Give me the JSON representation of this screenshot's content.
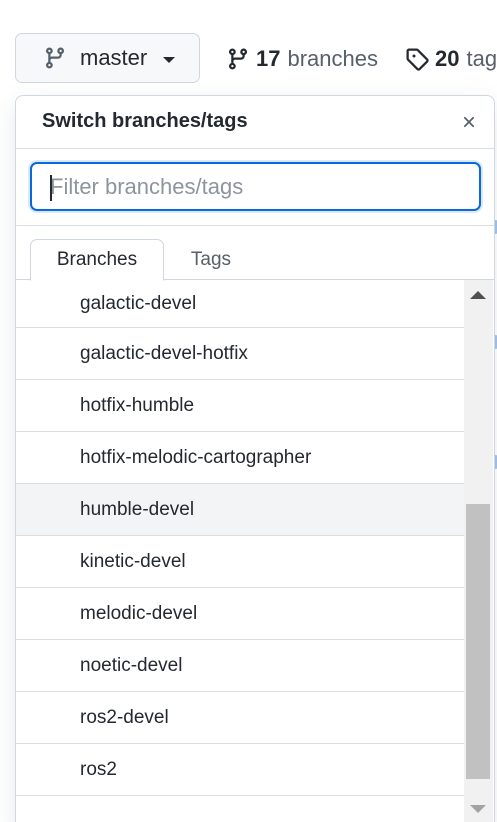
{
  "branch_button": {
    "label": "master",
    "icon": "git-branch-icon"
  },
  "stats": {
    "branches": {
      "count": "17",
      "label": "branches",
      "icon": "git-branch-icon"
    },
    "tags": {
      "count": "20",
      "label": "tags",
      "icon": "tag-icon"
    }
  },
  "popover": {
    "title": "Switch branches/tags",
    "close_icon": "x-icon",
    "filter": {
      "placeholder": "Filter branches/tags",
      "value": ""
    },
    "tabs": [
      {
        "label": "Branches",
        "selected": true
      },
      {
        "label": "Tags",
        "selected": false
      }
    ],
    "branches": [
      "galactic-devel",
      "galactic-devel-hotfix",
      "hotfix-humble",
      "hotfix-melodic-cartographer",
      "humble-devel",
      "kinetic-devel",
      "melodic-devel",
      "noetic-devel",
      "ros2-devel",
      "ros2"
    ],
    "hovered_branch": "humble-devel"
  },
  "colors": {
    "accent": "#0969da",
    "border": "#d0d7de",
    "hover": "#f3f4f6"
  }
}
